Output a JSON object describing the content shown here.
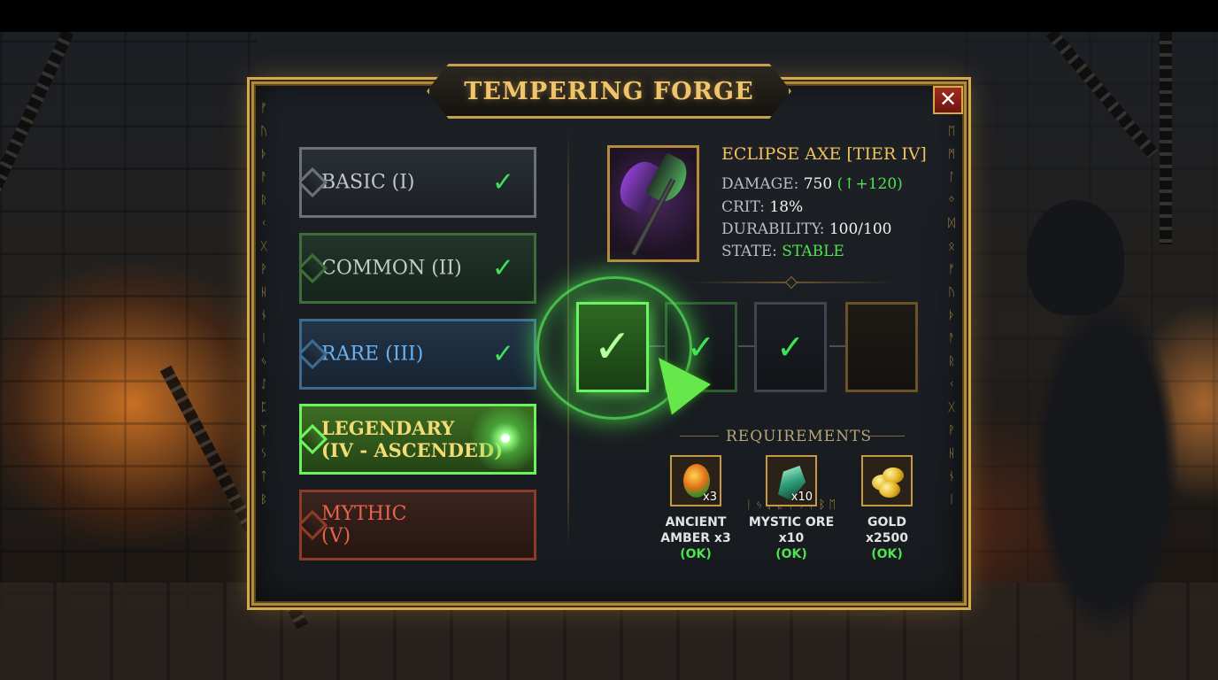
{
  "window": {
    "title": "TEMPERING FORGE",
    "close_label": "✕"
  },
  "tiers": [
    {
      "label": "BASIC (I)",
      "state": "complete",
      "check": "✓"
    },
    {
      "label": "COMMON (II)",
      "state": "complete",
      "check": "✓"
    },
    {
      "label": "RARE (III)",
      "state": "complete",
      "check": "✓"
    },
    {
      "label_line1": "LEGENDARY",
      "label_line2": "(IV - ASCENDED)",
      "state": "selected"
    },
    {
      "label_line1": "MYTHIC",
      "label_line2": "(V)",
      "state": "locked"
    }
  ],
  "item": {
    "name": "ECLIPSE AXE [TIER IV]",
    "damage_label": "DAMAGE:",
    "damage_value": "750",
    "damage_bonus": "(↑+120)",
    "crit_label": "CRIT:",
    "crit_value": "18%",
    "durability_label": "DURABILITY:",
    "durability_value": "100/100",
    "state_label": "STATE:",
    "state_value": "STABLE",
    "icon": "axe-icon"
  },
  "slots": [
    {
      "state": "filled",
      "mark": "✓"
    },
    {
      "state": "filled",
      "mark": "✓"
    },
    {
      "state": "filled",
      "mark": "✓"
    },
    {
      "state": "empty",
      "mark": ""
    }
  ],
  "requirements": {
    "title": "REQUIREMENTS",
    "items": [
      {
        "qty": "x3",
        "name_line1": "ANCIENT",
        "name_line2": "AMBER x3",
        "status": "(OK)",
        "icon": "amber-icon"
      },
      {
        "qty": "x10",
        "name_line1": "MYSTIC ORE",
        "name_line2": "x10",
        "status": "(OK)",
        "icon": "ore-icon"
      },
      {
        "qty": "",
        "name_line1": "GOLD",
        "name_line2": "x2500",
        "status": "(OK)",
        "icon": "gold-icon"
      }
    ]
  },
  "colors": {
    "accent_gold": "#d4a84d",
    "success_green": "#4ee34f",
    "rare_blue": "#6ab2ef",
    "mythic_red": "#e5644c",
    "legendary_yellow": "#f3dc73"
  }
}
